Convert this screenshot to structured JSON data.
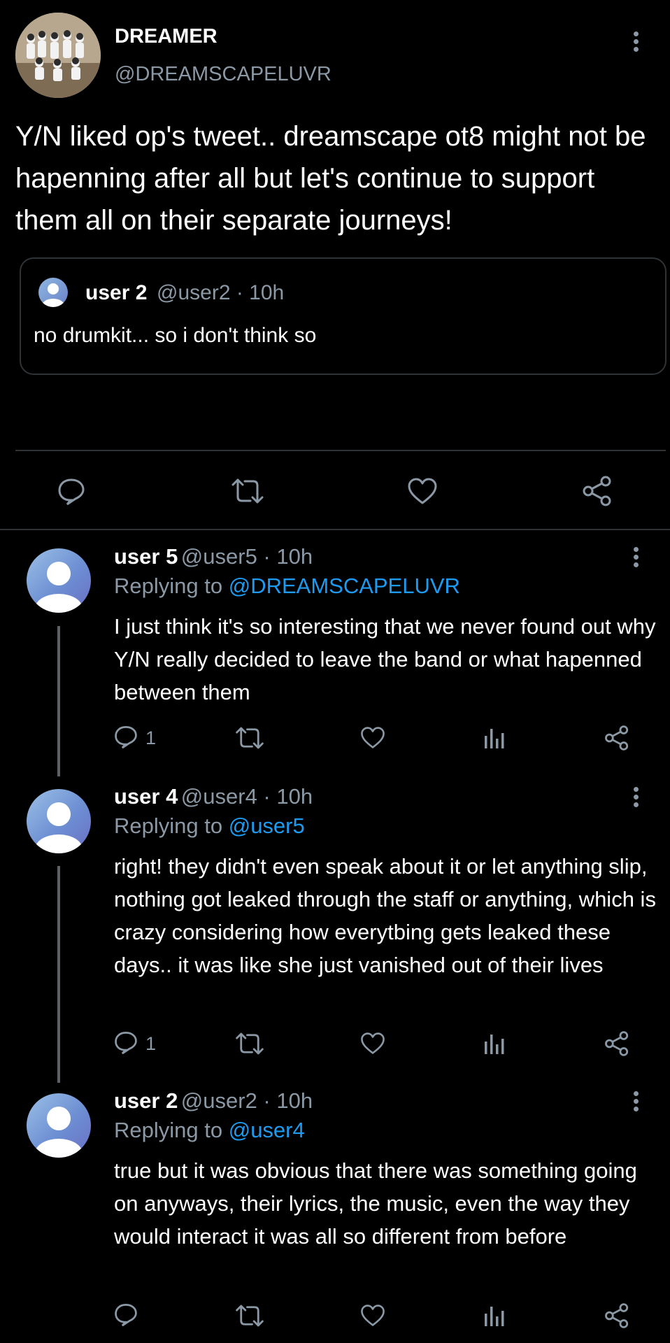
{
  "main_tweet": {
    "display_name": "DREAMER",
    "handle": "@DREAMSCAPELUVR",
    "text": "Y/N liked op's tweet.. dreamscape ot8 might not be hapenning after all but let's continue to support them all on their separate journeys!",
    "avatar_icon": "group-photo-avatar"
  },
  "quoted_tweet": {
    "display_name": "user 2",
    "meta": "@user2 · 10h",
    "text": "no drumkit... so i don't think so"
  },
  "replies": [
    {
      "display_name": "user 5",
      "meta": "@user5 · 10h",
      "replying_prefix": "Replying to",
      "replying_to": "@DREAMSCAPELUVR",
      "text": "I just think it's so interesting that we never found out why Y/N really decided to leave the band or what hapenned between them",
      "reply_count": "1"
    },
    {
      "display_name": "user 4",
      "meta": "@user4 · 10h",
      "replying_prefix": "Replying to",
      "replying_to": "@user5",
      "text": "right! they didn't even speak about it or let anything slip, nothing got leaked through the staff or anything, which is crazy considering how everytbing gets leaked these days.. it was like she just vanished out of their lives",
      "reply_count": "1"
    },
    {
      "display_name": "user 2",
      "meta": "@user2 · 10h",
      "replying_prefix": "Replying to",
      "replying_to": "@user4",
      "text": "true but it was obvious that there was something going on anyways, their lyrics, the music, even the way they would interact it was all so different from before",
      "reply_count": ""
    }
  ],
  "colors": {
    "background": "#000000",
    "text": "#ffffff",
    "secondary": "#8b98a5",
    "link": "#1d9bf0",
    "border": "#2f3336"
  }
}
